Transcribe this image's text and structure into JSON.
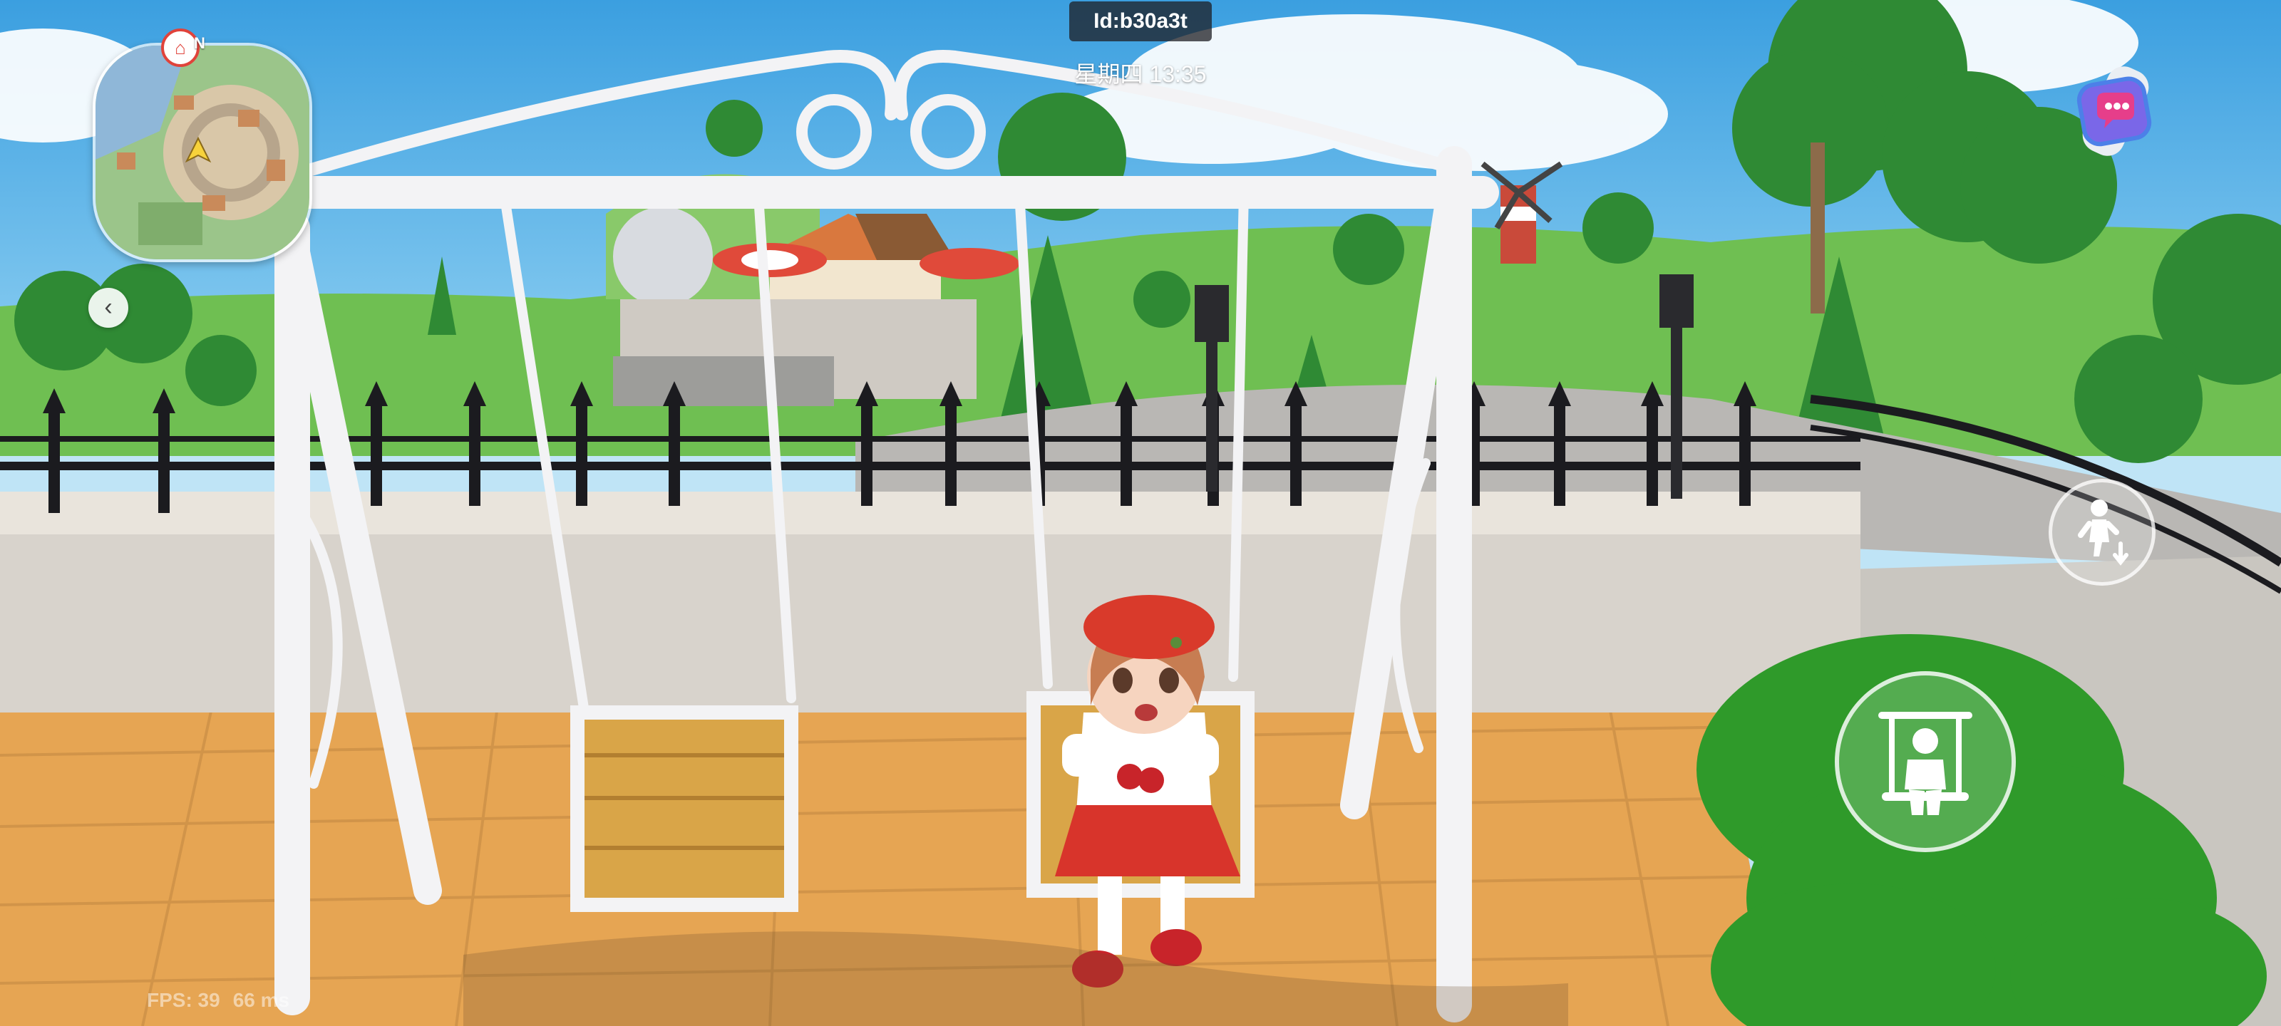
{
  "hud": {
    "player_id": "Id:b30a3t",
    "clock": "星期四 13:35",
    "minimap_north": "N",
    "fps_label": "FPS: 39",
    "ping_label": "66 ms"
  },
  "icons": {
    "back": "chevron-left-icon",
    "chat": "chat-watch-icon",
    "dismount": "dismount-figure-icon",
    "swing_action": "swing-icon",
    "map_pin": "home-pin-icon"
  },
  "colors": {
    "sky": "#5ab3e8",
    "grass": "#6cc04a",
    "plaza_tile": "#e6a553",
    "swing_frame": "#f3f3f5",
    "wall": "#d8d3cc",
    "fence": "#1b1b1f",
    "hat_red": "#d93a2b",
    "bush": "#2f9a2a"
  }
}
